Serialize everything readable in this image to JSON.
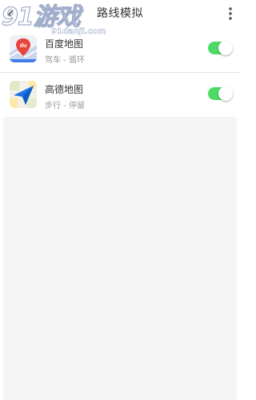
{
  "header": {
    "title": "路线模拟",
    "back_icon": "chevron-left-icon",
    "more_icon": "more-vertical-icon"
  },
  "watermark": {
    "main": "91游戏",
    "url": "91danji.com"
  },
  "routes": [
    {
      "name": "百度地图",
      "subtitle": "驾车 - 循环",
      "icon": "baidu-map-icon",
      "enabled": true
    },
    {
      "name": "高德地图",
      "subtitle": "步行 - 停留",
      "icon": "amap-icon",
      "enabled": true
    }
  ],
  "colors": {
    "toggle_on": "#4cd964",
    "background_empty": "#f5f5f5",
    "text_primary": "#333333",
    "text_secondary": "#999999",
    "divider": "#e4e4e4"
  }
}
